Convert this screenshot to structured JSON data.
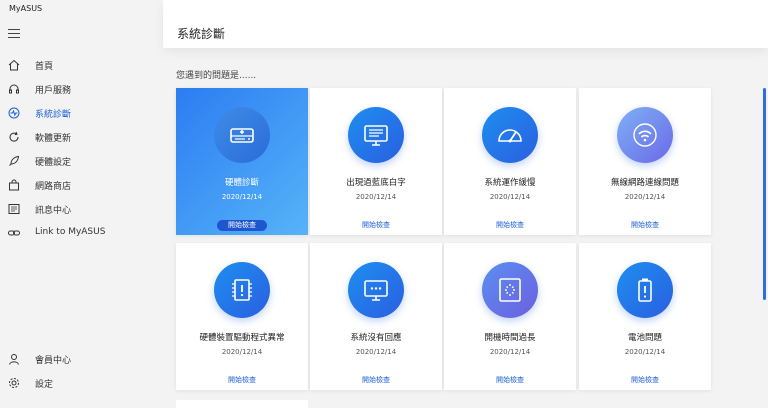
{
  "app": {
    "title": "MyASUS"
  },
  "window_controls": {
    "minimize": "—",
    "maximize": "⧉",
    "close": "✕"
  },
  "sidebar": {
    "items": [
      {
        "label": "首頁",
        "icon": "home-icon"
      },
      {
        "label": "用戶服務",
        "icon": "headset-icon"
      },
      {
        "label": "系統診斷",
        "icon": "diagnosis-icon",
        "active": true
      },
      {
        "label": "軟體更新",
        "icon": "update-icon"
      },
      {
        "label": "硬體設定",
        "icon": "rocket-icon"
      },
      {
        "label": "網路商店",
        "icon": "shopping-bag-icon"
      },
      {
        "label": "訊息中心",
        "icon": "news-icon"
      },
      {
        "label": "Link to MyASUS",
        "icon": "link-icon"
      }
    ],
    "bottom_items": [
      {
        "label": "會員中心",
        "icon": "user-icon"
      },
      {
        "label": "設定",
        "icon": "gear-icon"
      }
    ]
  },
  "main": {
    "title": "系統診斷",
    "subtitle": "您遇到的問題是......",
    "cards": [
      {
        "title": "硬體診斷",
        "date": "2020/12/14",
        "button": "開始檢查",
        "icon": "hard-drive-icon",
        "selected": true
      },
      {
        "title": "出現過藍底白字",
        "date": "2020/12/14",
        "button": "開始檢查",
        "icon": "monitor-icon"
      },
      {
        "title": "系統運作緩慢",
        "date": "2020/12/14",
        "button": "開始檢查",
        "icon": "speedometer-icon"
      },
      {
        "title": "無線網路連線問題",
        "date": "2020/12/14",
        "button": "開始檢查",
        "icon": "wifi-icon"
      },
      {
        "title": "硬體裝置驅動程式異常",
        "date": "2020/12/14",
        "button": "開始檢查",
        "icon": "chip-warning-icon"
      },
      {
        "title": "系統沒有回應",
        "date": "2020/12/14",
        "button": "開始檢查",
        "icon": "unresponsive-screen-icon"
      },
      {
        "title": "開機時間過長",
        "date": "2020/12/14",
        "button": "開始檢查",
        "icon": "boot-loading-icon"
      },
      {
        "title": "電池問題",
        "date": "2020/12/14",
        "button": "開始檢查",
        "icon": "battery-warning-icon"
      }
    ]
  },
  "colors": {
    "accent": "#1a5fd6",
    "selected_card_start": "#2d7cf2",
    "selected_card_end": "#55b4f8"
  }
}
